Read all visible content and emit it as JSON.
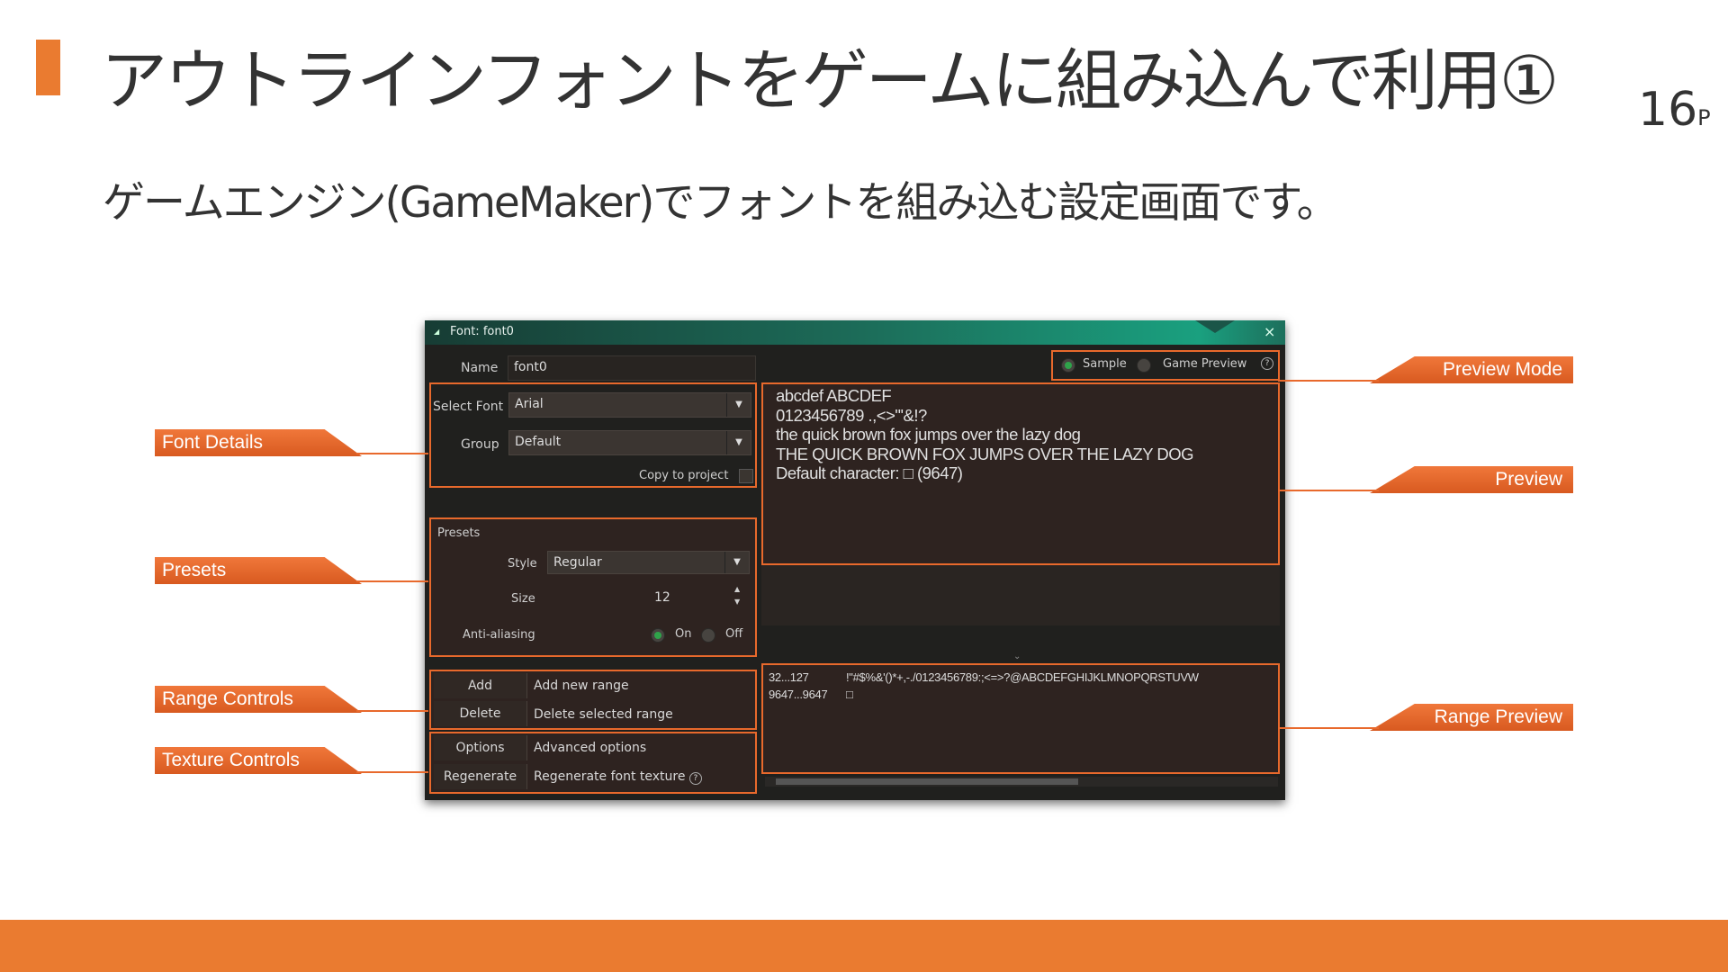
{
  "slide": {
    "title": "アウトラインフォントをゲームに組み込んで利用①",
    "page_number": "16",
    "page_suffix": "P",
    "subtitle": "ゲームエンジン(GameMaker)でフォントを組み込む設定画面です。"
  },
  "window": {
    "title": "Font: font0",
    "close_icon": "×",
    "name_label": "Name",
    "name_value": "font0",
    "select_font_label": "Select Font",
    "select_font_value": "Arial",
    "group_label": "Group",
    "group_value": "Default",
    "copy_to_project_label": "Copy to project",
    "presets_label": "Presets",
    "style_label": "Style",
    "style_value": "Regular",
    "size_label": "Size",
    "size_value": "12",
    "anti_aliasing_label": "Anti-aliasing",
    "aa_on_label": "On",
    "aa_off_label": "Off",
    "preview_mode": {
      "sample_label": "Sample",
      "game_preview_label": "Game Preview",
      "help_icon": "?"
    },
    "preview_lines": [
      "abcdef ABCDEF",
      "0123456789 .,<>\"'&!?",
      "the quick brown fox jumps over the lazy dog",
      "THE QUICK BROWN FOX JUMPS OVER THE LAZY DOG",
      "Default character:  □  (9647)"
    ],
    "buttons": [
      {
        "label": "Add",
        "desc": "Add new range"
      },
      {
        "label": "Delete",
        "desc": "Delete selected range"
      },
      {
        "label": "Options",
        "desc": "Advanced options"
      },
      {
        "label": "Regenerate",
        "desc": "Regenerate font texture"
      }
    ],
    "ranges": [
      {
        "range": "32...127",
        "chars": "!\"#$%&'()*+,-./0123456789:;<=>?@ABCDEFGHIJKLMNOPQRSTUVW"
      },
      {
        "range": "9647...9647",
        "chars": "□"
      }
    ]
  },
  "callouts": {
    "font_details": "Font Details",
    "presets": "Presets",
    "range_controls": "Range Controls",
    "texture_controls": "Texture Controls",
    "preview_mode": "Preview Mode",
    "preview": "Preview",
    "range_preview": "Range Preview"
  },
  "colors": {
    "accent": "#ea7b30",
    "highlight_box": "#e8692c",
    "titlebar_teal": "#1aa07f",
    "radio_on": "#2fa34a"
  }
}
